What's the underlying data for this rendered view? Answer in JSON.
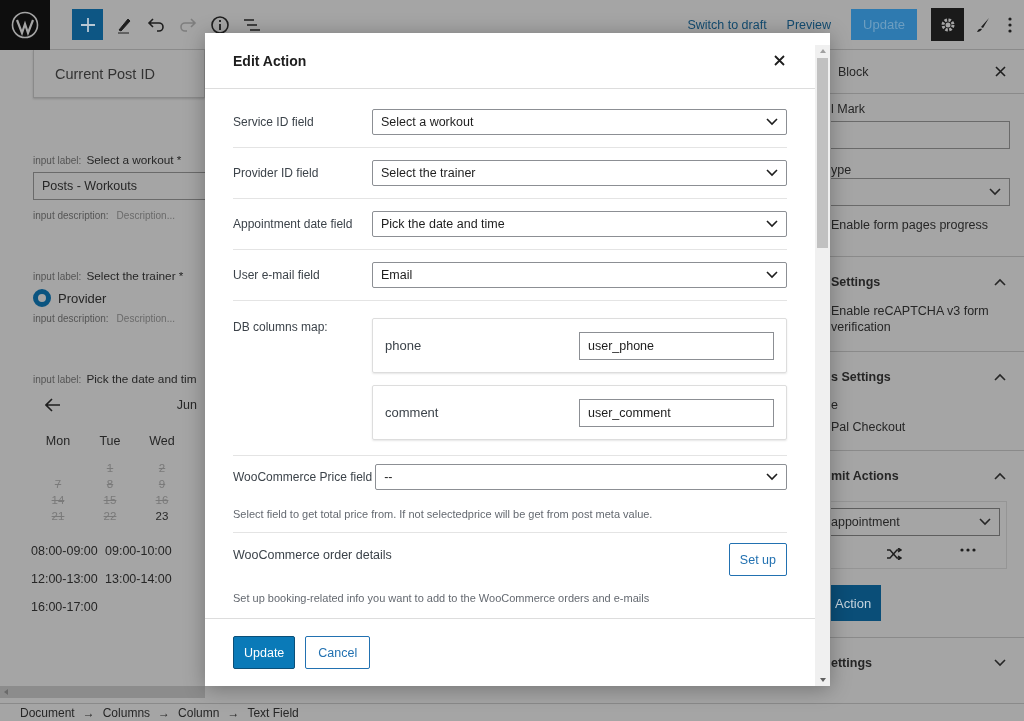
{
  "toolbar": {
    "links": [
      "Switch to draft",
      "Preview"
    ],
    "update": "Update"
  },
  "editor": {
    "block_title": "Current Post ID",
    "select_field": {
      "prefix": "input label:",
      "label": "Select a workout *",
      "value": "Posts - Workouts",
      "desc_prefix": "input description:",
      "desc": "Description..."
    },
    "radio_field": {
      "prefix": "input label:",
      "label": "Select the trainer *",
      "option": "Provider",
      "selected": true,
      "desc_prefix": "input description:",
      "desc": "Description..."
    },
    "date_field": {
      "prefix": "input label:",
      "label": "Pick the date and tim",
      "month": "Jun",
      "weekdays": [
        "Mon",
        "Tue",
        "Wed"
      ],
      "weeks": [
        [
          {
            "day": "1",
            "disabled": true
          },
          {
            "day": "2",
            "disabled": true
          }
        ],
        [
          {
            "day": "7",
            "disabled": true
          },
          {
            "day": "8",
            "disabled": true
          },
          {
            "day": "9",
            "disabled": true
          }
        ],
        [
          {
            "day": "14",
            "disabled": true
          },
          {
            "day": "15",
            "disabled": true
          },
          {
            "day": "16",
            "disabled": true
          }
        ],
        [
          {
            "day": "21",
            "disabled": true
          },
          {
            "day": "22",
            "disabled": true
          },
          {
            "day": "23",
            "disabled": false
          }
        ]
      ],
      "time_slots": [
        "08:00-09:00",
        "09:00-10:00",
        "12:00-13:00",
        "13:00-14:00",
        "16:00-17:00"
      ]
    }
  },
  "sidebar": {
    "tab": "Block",
    "mark_label": "l Mark",
    "type_label": "ype",
    "progress_option": "Enable form pages progress",
    "panels": [
      {
        "kind": "text",
        "title": "Settings",
        "expanded": true,
        "lines": [
          "Enable reCAPTCHA v3 form verification"
        ]
      },
      {
        "kind": "lines",
        "title": "s Settings",
        "expanded": true,
        "lines": [
          "e",
          "Pal Checkout"
        ]
      },
      {
        "kind": "actions",
        "title": "mit Actions",
        "expanded": true,
        "action": "appointment",
        "button": "Action"
      },
      {
        "title": "ettings",
        "expanded": false
      }
    ]
  },
  "modal": {
    "title": "Edit Action",
    "fields": [
      {
        "kind": "select",
        "label": "Service ID field",
        "value": "Select a workout"
      },
      {
        "kind": "select",
        "label": "Provider ID field",
        "value": "Select the trainer"
      },
      {
        "kind": "select",
        "label": "Appointment date field",
        "value": "Pick the date and time"
      },
      {
        "kind": "select",
        "label": "User e-mail field",
        "value": "Email"
      },
      {
        "kind": "map",
        "label": "DB columns map:",
        "entries": [
          {
            "column": "phone",
            "value": "user_phone"
          },
          {
            "column": "comment",
            "value": "user_comment"
          }
        ]
      },
      {
        "kind": "select",
        "label": "WooCommerce Price field",
        "value": "--",
        "help": "Select field to get total price from. If not selectedprice will be get from post meta value."
      },
      {
        "kind": "button",
        "label": "WooCommerce order details",
        "button": "Set up",
        "help": "Set up booking-related info you want to add to the WooCommerce orders and e-mails"
      }
    ],
    "buttons": [
      {
        "kind": "primary",
        "label": "Update"
      },
      {
        "kind": "secondary",
        "label": "Cancel"
      }
    ]
  },
  "breadcrumb": {
    "items": [
      "Document",
      "Columns",
      "Column",
      "Text Field"
    ],
    "separator": "→"
  }
}
